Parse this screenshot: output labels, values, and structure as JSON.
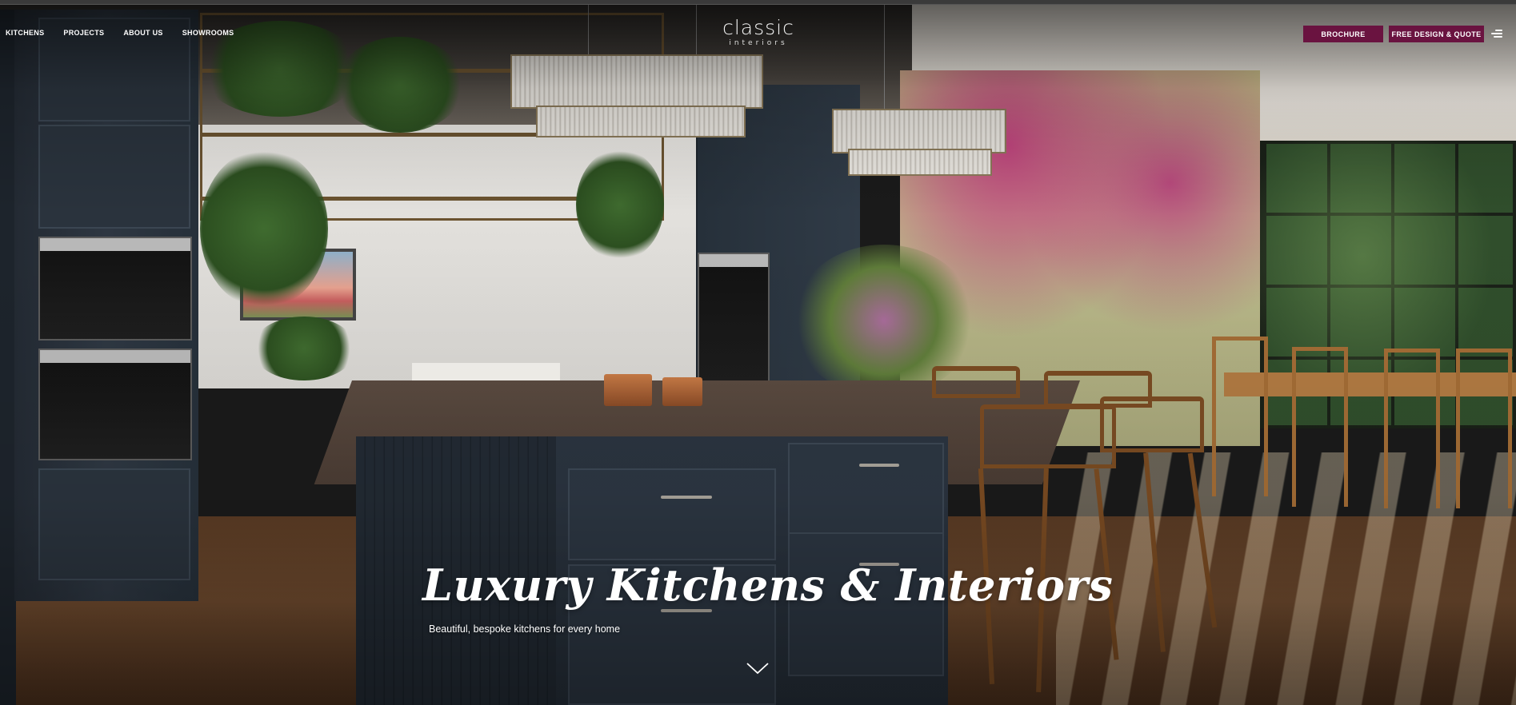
{
  "nav": {
    "links": [
      {
        "label": "KITCHENS"
      },
      {
        "label": "PROJECTS"
      },
      {
        "label": "ABOUT US"
      },
      {
        "label": "SHOWROOMS"
      }
    ]
  },
  "logo": {
    "main": "classic",
    "sub": "interiors"
  },
  "buttons": {
    "brochure": "BROCHURE",
    "quote": "FREE DESIGN & QUOTE"
  },
  "hero": {
    "title": "Luxury Kitchens & Interiors",
    "subtitle": "Beautiful, bespoke kitchens for every home"
  },
  "icons": {
    "menu": "menu-icon",
    "scroll": "chevron-down-icon"
  },
  "colors": {
    "accent": "#6a1340",
    "text": "#ffffff"
  }
}
